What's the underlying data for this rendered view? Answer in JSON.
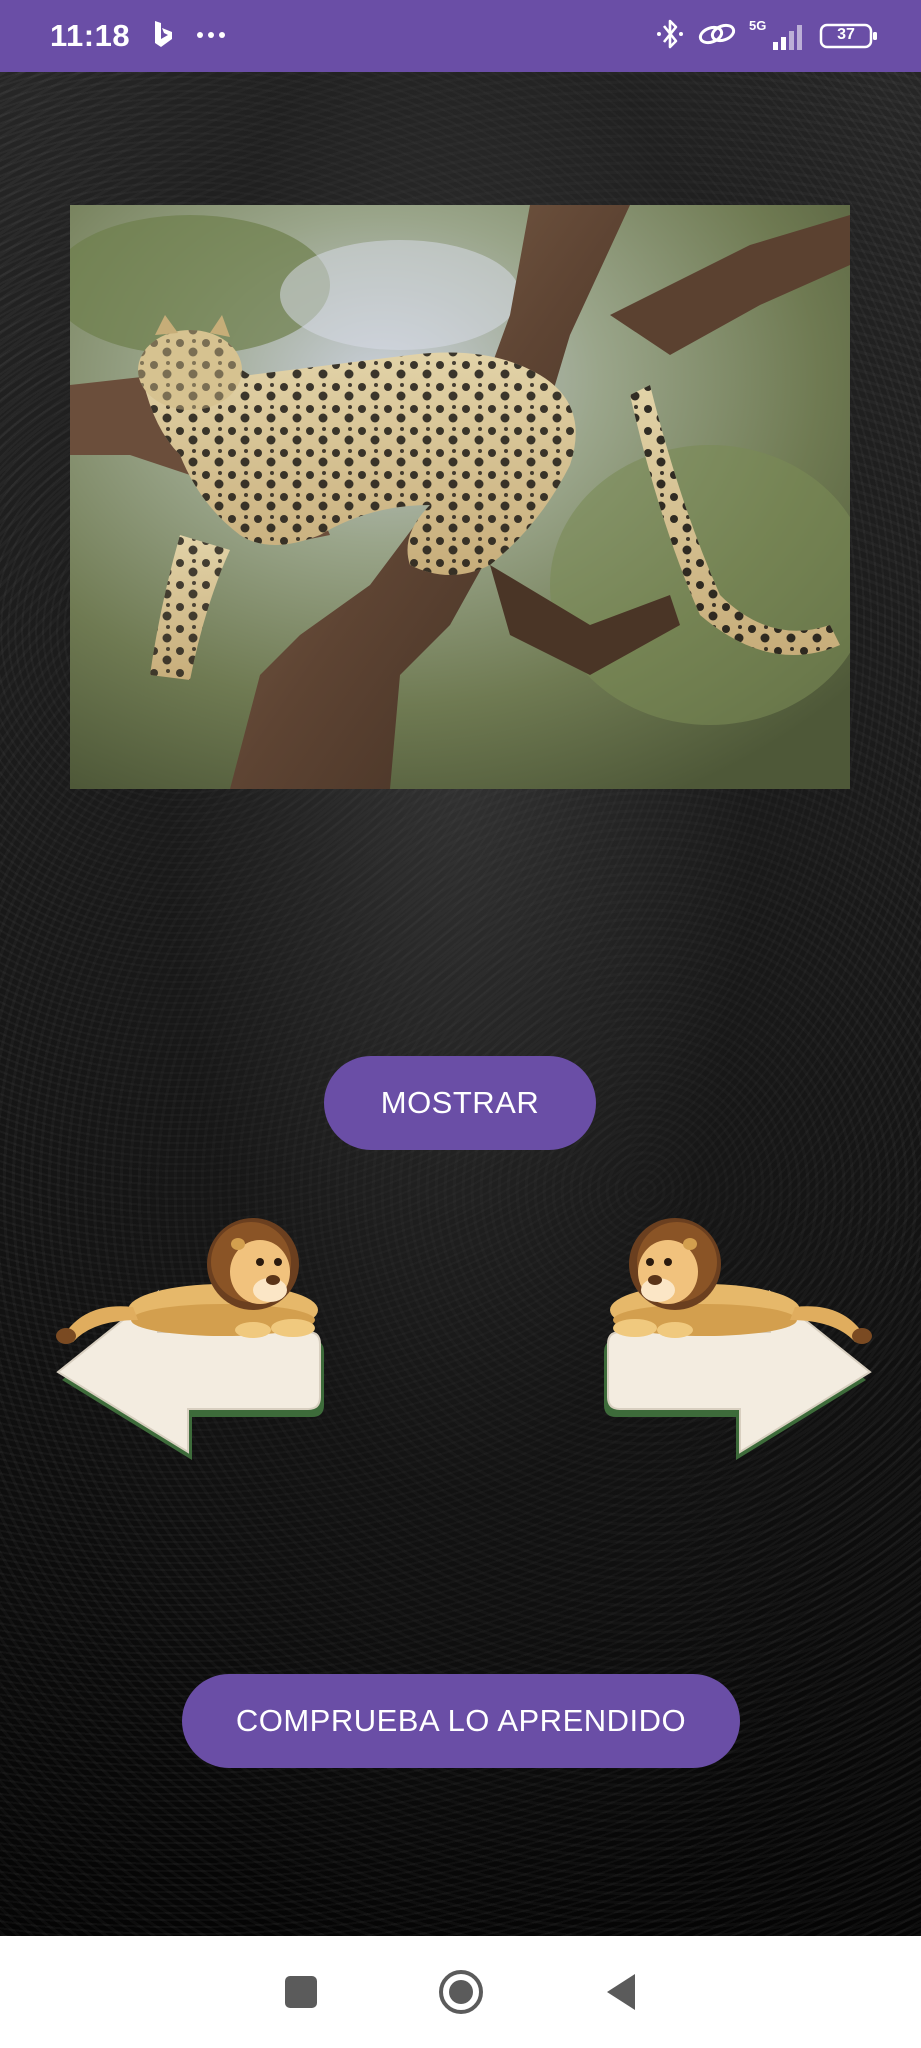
{
  "status_bar": {
    "time": "11:18",
    "network": "5G",
    "battery": "37",
    "icons": [
      "bing-icon",
      "more-dots-icon",
      "bluetooth-icon",
      "link-icon",
      "signal-5g-icon",
      "battery-icon"
    ]
  },
  "main": {
    "photo": {
      "subject": "leopard resting on tree branch",
      "icon": "photo-image"
    },
    "show_button_label": "MOSTRAR",
    "prev_icon": "lion-left-arrow-icon",
    "next_icon": "lion-right-arrow-icon",
    "quiz_button_label": "COMPRUEBA LO APRENDIDO"
  },
  "colors": {
    "accent": "#6a4ea6",
    "status_bar": "#6a4ea6",
    "background": "#141414",
    "nav_bar": "#ffffff"
  },
  "nav_bar": {
    "icons": [
      "recents-square-icon",
      "home-circle-icon",
      "back-triangle-icon"
    ]
  }
}
